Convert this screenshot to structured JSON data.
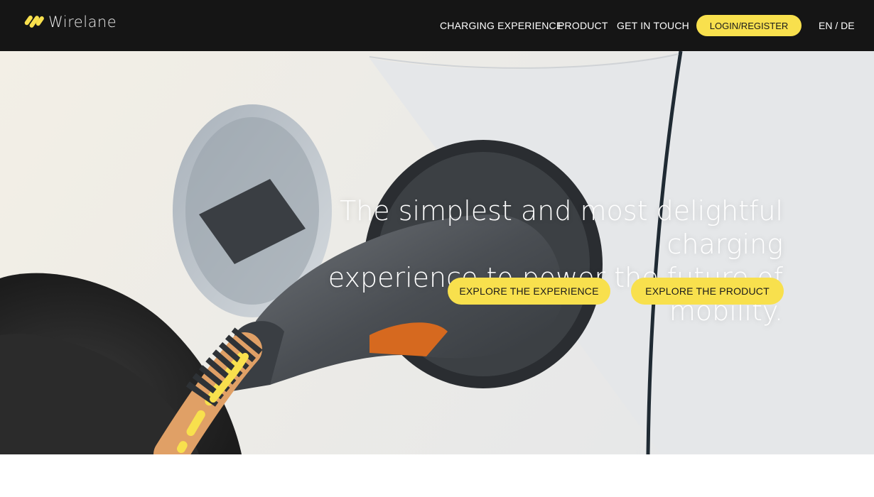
{
  "header": {
    "brand": "Wirelane",
    "nav": [
      "CHARGING EXPERIENCE",
      "PRODUCT",
      "GET IN TOUCH"
    ],
    "login_label": "LOGIN/REGISTER",
    "lang_en": "EN",
    "lang_sep": "/",
    "lang_de": "DE"
  },
  "hero": {
    "headline_line1": "The simplest and most delightful charging",
    "headline_line2": "experience to power the future of mobility.",
    "cta_experience": "EXPLORE THE EXPERIENCE",
    "cta_product": "EXPLORE THE PRODUCT"
  },
  "colors": {
    "header_bg": "#151515",
    "accent_yellow": "#f8e04d",
    "cable_orange": "#e0a066"
  },
  "icons": {
    "logo": "wirelane-logo-icon"
  }
}
